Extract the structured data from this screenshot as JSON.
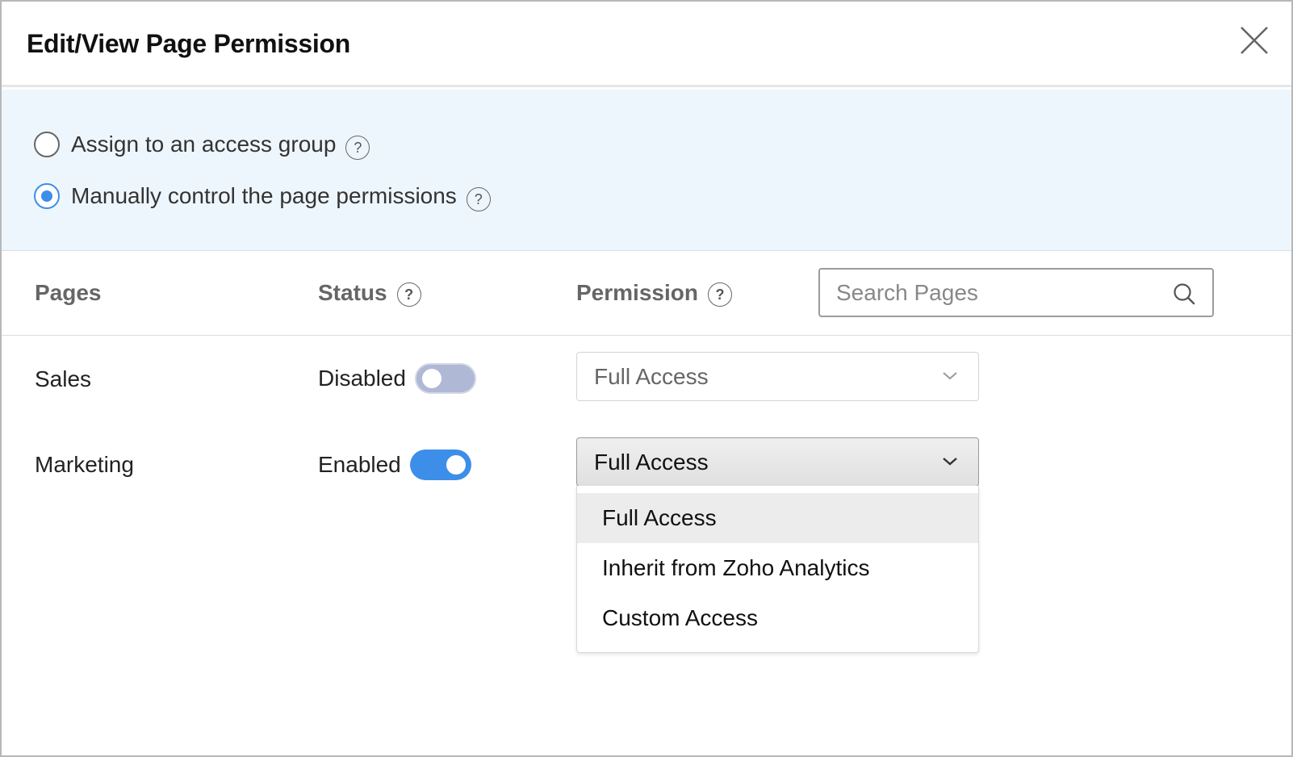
{
  "dialog": {
    "title": "Edit/View Page Permission"
  },
  "mode": {
    "options": [
      {
        "label": "Assign to an access group",
        "selected": false
      },
      {
        "label": "Manually control the page permissions",
        "selected": true
      }
    ],
    "accent_color": "#3d8ee9",
    "panel_bg": "#eef6fd"
  },
  "table": {
    "headers": {
      "pages": "Pages",
      "status": "Status",
      "permission": "Permission"
    },
    "search": {
      "placeholder": "Search Pages",
      "value": ""
    },
    "rows": [
      {
        "page": "Sales",
        "status": "Disabled",
        "enabled": false,
        "permission": "Full Access"
      },
      {
        "page": "Marketing",
        "status": "Enabled",
        "enabled": true,
        "permission": "Full Access"
      }
    ]
  },
  "permission_dropdown": {
    "open_for_row": "Marketing",
    "options": [
      "Full Access",
      "Inherit from Zoho Analytics",
      "Custom Access"
    ],
    "highlighted": "Full Access"
  },
  "icons": {
    "close": "close-icon",
    "help": "help-icon",
    "search": "search-icon",
    "chevron": "chevron-down-icon",
    "help_glyph": "?"
  }
}
